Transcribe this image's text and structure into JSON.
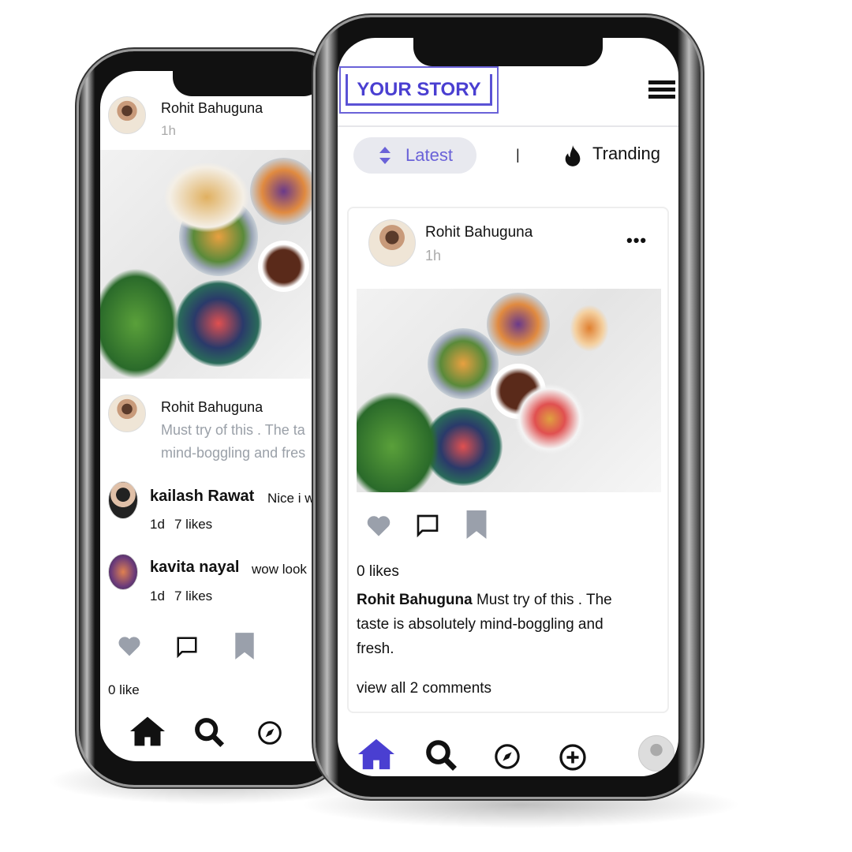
{
  "brand_color": "#4a3fd1",
  "left_phone": {
    "post": {
      "author": "Rohit Bahuguna",
      "time": "1h"
    },
    "caption": {
      "author": "Rohit Bahuguna",
      "line1": "Must try of this . The ta",
      "line2": "mind-boggling and fres"
    },
    "comments": [
      {
        "author": "kailash Rawat",
        "text": "Nice i w",
        "time": "1d",
        "likes": "7 likes"
      },
      {
        "author": "kavita nayal",
        "text": "wow look",
        "time": "1d",
        "likes": "7 likes"
      }
    ],
    "likes": "0 like",
    "nav": [
      "home-icon",
      "search-icon",
      "compass-icon"
    ]
  },
  "right_phone": {
    "header": {
      "logo": "YOUR STORY",
      "menu_icon": "hamburger-icon"
    },
    "filters": {
      "latest": "Latest",
      "separator": "|",
      "trending": "Tranding"
    },
    "post": {
      "author": "Rohit Bahuguna",
      "time": "1h",
      "likes": "0 likes",
      "caption_author": "Rohit Bahuguna",
      "caption_text": " Must try of this . The taste is absolutely mind-boggling and fresh.",
      "view_comments": "view all 2 comments"
    },
    "nav": [
      "home-icon",
      "search-icon",
      "compass-icon",
      "plus-circle-icon",
      "profile-avatar"
    ]
  }
}
